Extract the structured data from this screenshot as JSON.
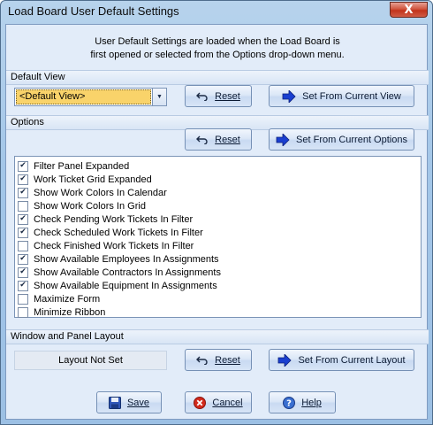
{
  "window": {
    "title": "Load Board User Default Settings",
    "close_glyph": "X"
  },
  "info": {
    "line1": "User Default Settings are loaded when the Load Board is",
    "line2": "first opened or selected  from the Options drop-down menu."
  },
  "default_view": {
    "header": "Default View",
    "combo_value": "<Default View>",
    "reset_label": "Reset",
    "set_label": "Set From Current View"
  },
  "options": {
    "header": "Options",
    "reset_label": "Reset",
    "set_label": "Set From Current Options",
    "items": [
      {
        "label": "Filter Panel Expanded",
        "checked": true
      },
      {
        "label": "Work Ticket Grid Expanded",
        "checked": true
      },
      {
        "label": "Show Work Colors In Calendar",
        "checked": true
      },
      {
        "label": "Show Work Colors In Grid",
        "checked": false
      },
      {
        "label": "Check Pending Work Tickets In Filter",
        "checked": true
      },
      {
        "label": "Check Scheduled Work Tickets In Filter",
        "checked": true
      },
      {
        "label": "Check Finished Work Tickets In Filter",
        "checked": false
      },
      {
        "label": "Show Available Employees In Assignments",
        "checked": true
      },
      {
        "label": "Show Available Contractors In Assignments",
        "checked": true
      },
      {
        "label": "Show Available Equipment In Assignments",
        "checked": true
      },
      {
        "label": "Maximize Form",
        "checked": false
      },
      {
        "label": "Minimize Ribbon",
        "checked": false
      }
    ]
  },
  "layout": {
    "header": "Window and Panel Layout",
    "status": "Layout Not Set",
    "reset_label": "Reset",
    "set_label": "Set From Current Layout"
  },
  "footer": {
    "save_label": "Save",
    "cancel_label": "Cancel",
    "help_label": "Help"
  },
  "colors": {
    "accent": "#1a3fd0",
    "combo_highlight": "#f9d36a",
    "cancel_red": "#d22a1d"
  }
}
